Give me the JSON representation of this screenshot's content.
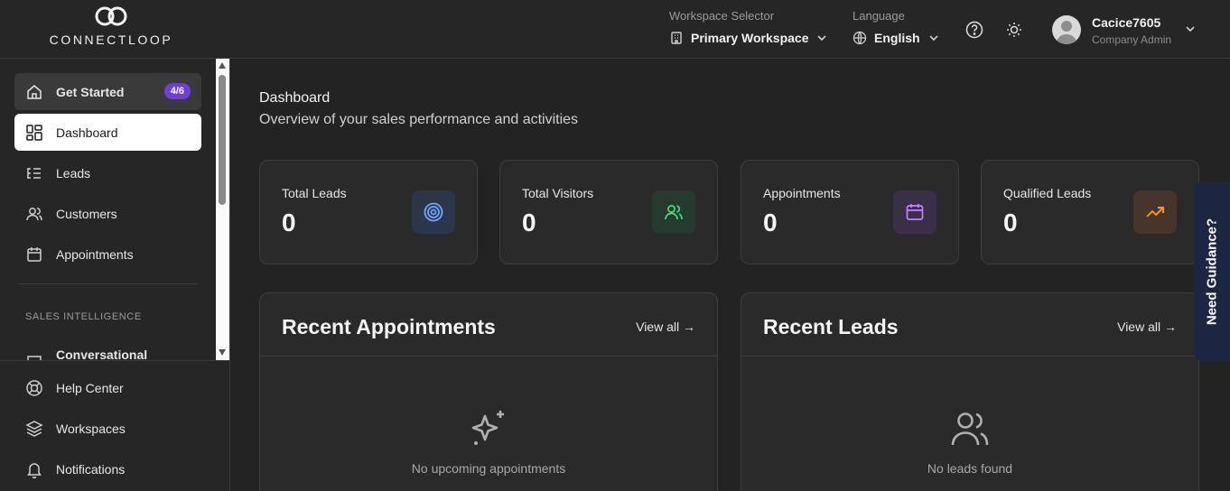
{
  "app": {
    "logo_text": "CONNECTLOOP"
  },
  "header": {
    "workspace_label": "Workspace Selector",
    "workspace_value": "Primary Workspace",
    "language_label": "Language",
    "language_value": "English",
    "user_name": "Cacice7605",
    "user_role": "Company Admin",
    "icons": [
      "help-circle-icon",
      "sun-icon"
    ]
  },
  "sidebar": {
    "get_started": {
      "label": "Get Started",
      "badge": "4/6"
    },
    "items": [
      {
        "label": "Dashboard",
        "icon": "dashboard-icon",
        "active": true
      },
      {
        "label": "Leads",
        "icon": "list-icon"
      },
      {
        "label": "Customers",
        "icon": "users-icon"
      },
      {
        "label": "Appointments",
        "icon": "calendar-icon"
      }
    ],
    "section_label": "SALES INTELLIGENCE",
    "partial_item": "Conversational",
    "bottom": [
      {
        "label": "Help Center",
        "icon": "life-buoy-icon"
      },
      {
        "label": "Workspaces",
        "icon": "layers-icon"
      },
      {
        "label": "Notifications",
        "icon": "bell-icon"
      }
    ]
  },
  "main": {
    "title": "Dashboard",
    "subtitle": "Overview of your sales performance and activities",
    "stats": [
      {
        "label": "Total Leads",
        "value": "0",
        "icon": "target-icon",
        "color": "#6fa8ff"
      },
      {
        "label": "Total Visitors",
        "value": "0",
        "icon": "users-icon",
        "color": "#4ade80"
      },
      {
        "label": "Appointments",
        "value": "0",
        "icon": "calendar-icon",
        "color": "#c084fc"
      },
      {
        "label": "Qualified Leads",
        "value": "0",
        "icon": "trending-up-icon",
        "color": "#f59e0b"
      }
    ],
    "panels": [
      {
        "title": "Recent Appointments",
        "view_all": "View all →",
        "empty_text": "No upcoming appointments",
        "icon": "sparkles-icon"
      },
      {
        "title": "Recent Leads",
        "view_all": "View all →",
        "empty_text": "No leads found",
        "icon": "users-icon"
      }
    ]
  },
  "guidance": {
    "label": "Need Guidance?"
  }
}
